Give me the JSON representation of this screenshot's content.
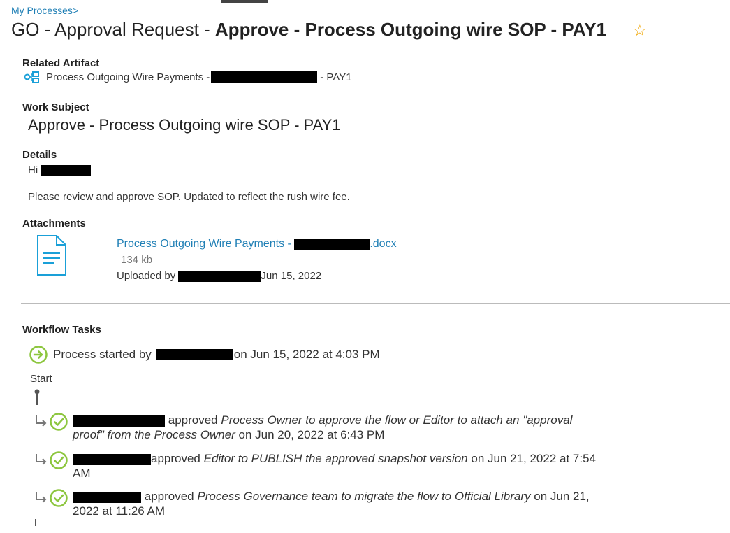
{
  "breadcrumb": "My Processes>",
  "title": {
    "prefix": "GO - Approval Request - ",
    "bold": "Approve - Process Outgoing wire SOP - PAY1"
  },
  "favorite_icon": "star-icon",
  "related_artifact": {
    "label": "Related Artifact",
    "name_prefix": "Process Outgoing Wire Payments -",
    "name_suffix": "- PAY1"
  },
  "work_subject": {
    "label": "Work Subject",
    "value": "Approve - Process Outgoing wire SOP - PAY1"
  },
  "details": {
    "label": "Details",
    "greeting": "Hi",
    "body": "Please review and approve SOP. Updated to reflect the rush wire fee."
  },
  "attachments": {
    "label": "Attachments",
    "items": [
      {
        "name_prefix": "Process Outgoing Wire Payments -",
        "name_suffix": ".docx",
        "size": "134 kb",
        "uploaded_prefix": "Uploaded by",
        "uploaded_date": "Jun 15, 2022"
      }
    ]
  },
  "workflow": {
    "label": "Workflow Tasks",
    "started_prefix": "Process started by",
    "started_suffix": "on Jun 15, 2022 at 4:03 PM",
    "start_label": "Start",
    "tasks": [
      {
        "verb": "approved",
        "task": "Process Owner to approve the flow or Editor to attach an \"approval",
        "task2": "proof\" from the Process Owner",
        "when": "on Jun 20, 2022 at 6:43 PM"
      },
      {
        "verb": "approved",
        "task": "Editor to PUBLISH the approved snapshot version",
        "when": "on Jun 21, 2022 at 7:54",
        "when2": "AM"
      },
      {
        "verb": "approved",
        "task": "Process Governance team to migrate the flow to Official Library",
        "when": "on Jun 21,",
        "when2": "2022 at 11:26 AM"
      }
    ]
  },
  "colors": {
    "link": "#1f7fb5",
    "accent_rule": "#1f8ab8",
    "check_green": "#8dc63f",
    "star": "#f0a500",
    "doc_blue": "#1aa0d8"
  }
}
